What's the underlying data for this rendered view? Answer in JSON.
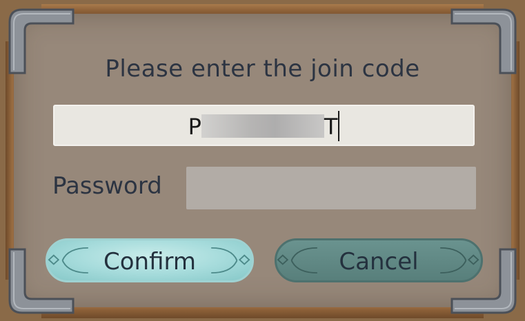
{
  "dialog": {
    "title": "Please enter the join code",
    "code_input": {
      "value_start": "P",
      "value_end": "T"
    },
    "password": {
      "label": "Password",
      "value": ""
    },
    "buttons": {
      "confirm_label": "Confirm",
      "cancel_label": "Cancel"
    }
  },
  "colors": {
    "panel": "#97887a",
    "text": "#2c3442",
    "confirm_button": "#a7dcdc",
    "cancel_button": "#587f7b"
  }
}
